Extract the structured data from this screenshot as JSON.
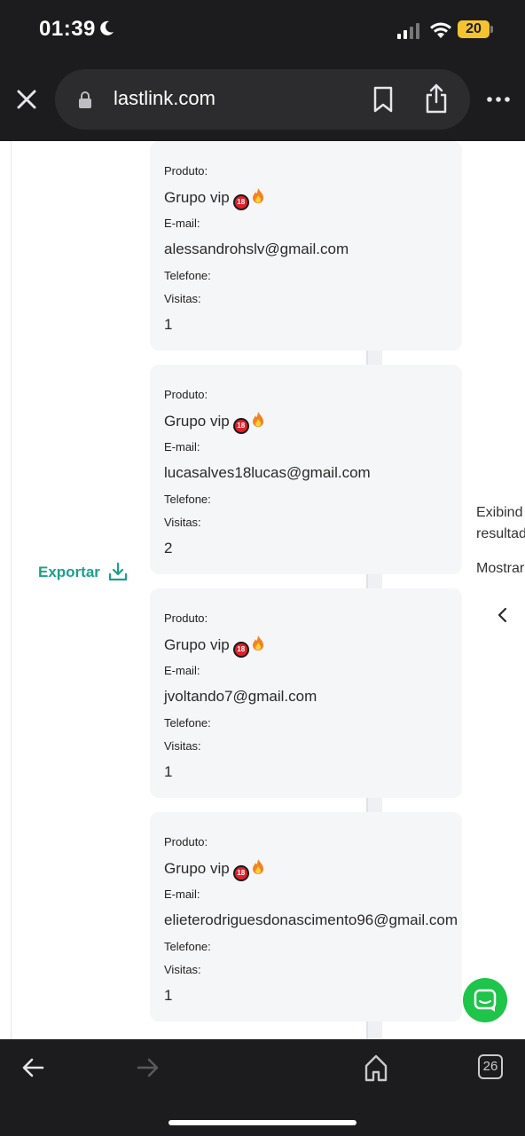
{
  "status_bar": {
    "time": "01:39",
    "battery": "20"
  },
  "browser": {
    "url": "lastlink.com",
    "tab_count": "26"
  },
  "labels": {
    "product": "Produto:",
    "email": "E-mail:",
    "phone": "Telefone:",
    "visits": "Visitas:"
  },
  "leads": [
    {
      "product": "Grupo vip",
      "email": "alessandrohslv@gmail.com",
      "phone": "",
      "visits": "1"
    },
    {
      "product": "Grupo vip",
      "email": "lucasalves18lucas@gmail.com",
      "phone": "",
      "visits": "2"
    },
    {
      "product": "Grupo vip",
      "email": "jvoltando7@gmail.com",
      "phone": "",
      "visits": "1"
    },
    {
      "product": "Grupo vip",
      "email": "elieterodriguesdonascimento96@gmail.com",
      "phone": "",
      "visits": "1"
    }
  ],
  "emoji_18": "18",
  "export_label": "Exportar",
  "right_panel": {
    "line1": "Exibind",
    "line2": "resultad",
    "line3": "Mostrar"
  },
  "colors": {
    "accent": "#1aa08c",
    "chat": "#1fc44a",
    "chrome": "#1c1c1e"
  }
}
